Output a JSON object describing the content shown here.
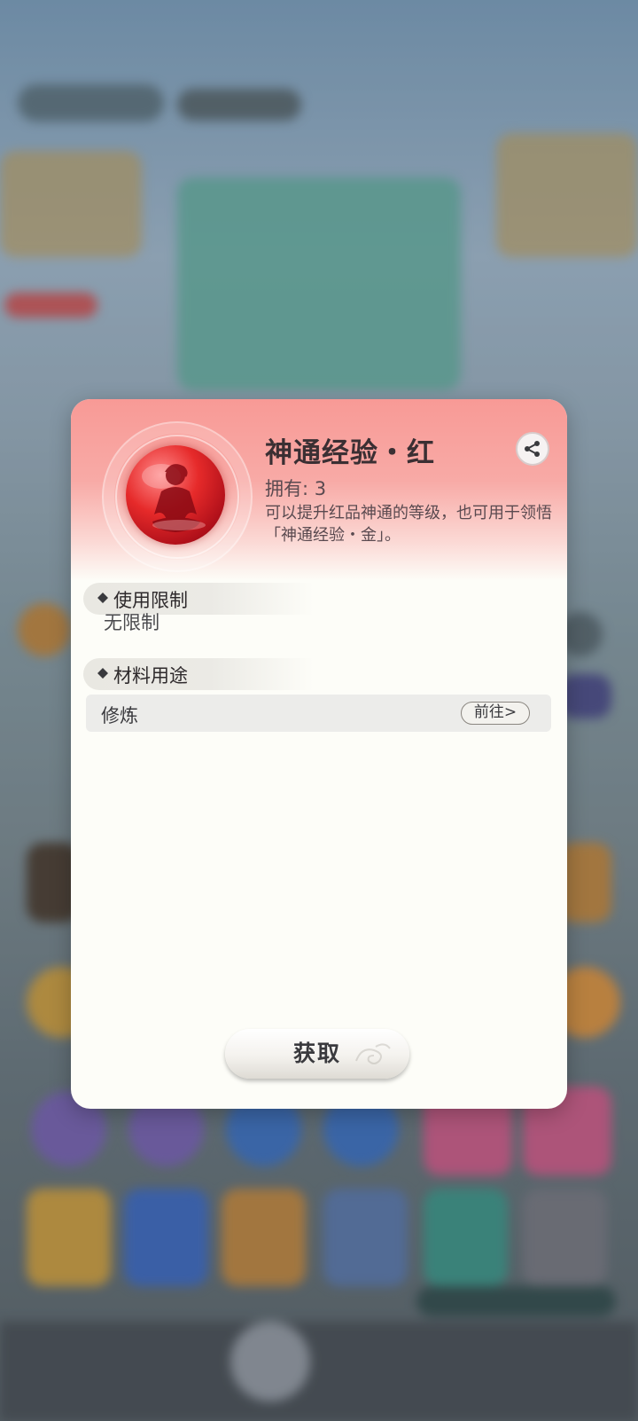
{
  "item": {
    "title": "神通经验・红",
    "owned": "拥有: 3",
    "description": "可以提升红品神通的等级，也可用于领悟「神通经验・金」。"
  },
  "sections": {
    "restriction": {
      "header": "使用限制",
      "value": "无限制"
    },
    "usage": {
      "header": "材料用途",
      "rows": [
        {
          "label": "修炼",
          "action": "前往>"
        }
      ]
    }
  },
  "buttons": {
    "obtain": "获取"
  },
  "icons": {
    "share": "share-icon",
    "item": "red-orb-silhouette-icon",
    "bullet": "diamond-bullet-icon"
  },
  "colors": {
    "header_pink": "#f89a96",
    "dialog_bg": "#fdfdf8",
    "orb_red": "#e62a2a"
  }
}
